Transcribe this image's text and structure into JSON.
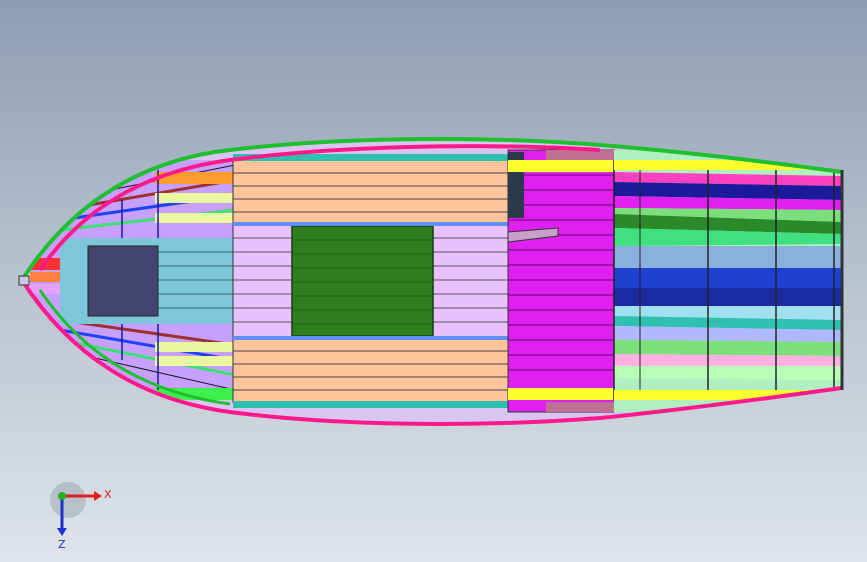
{
  "scene": {
    "model": "boat-hull-top-view",
    "background_top": "#8c9db0",
    "background_bottom": "#dfe4ea"
  },
  "triad": {
    "x_label": "X",
    "z_label": "Z",
    "x_color": "#e02020",
    "z_color": "#2030d0",
    "y_color": "#20b020"
  },
  "colors": {
    "gunwale_outer": "#1fbf2f",
    "gunwale_inner": "#ff1a8c",
    "deck_orange": "#ffc49a",
    "deck_lilac": "#e8c2ff",
    "hatch_green": "#2f7f1f",
    "helm_magenta": "#e020f0",
    "bow_block": "#43456e",
    "bow_strip": "#7ec7d9",
    "trim_teal": "#2fc0b0",
    "yellow": "#ffff30"
  }
}
